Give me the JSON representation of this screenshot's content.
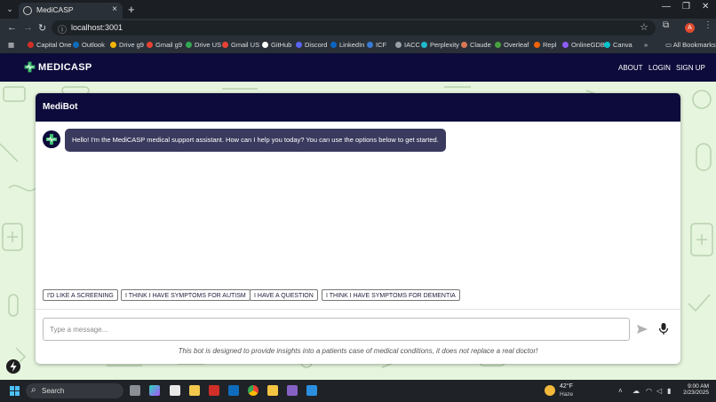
{
  "browser": {
    "tab_title": "MediCASP",
    "tab_close": "×",
    "new_tab": "+",
    "url": "localhost:3001",
    "bookmarks": [
      {
        "label": "Capital One",
        "color": "#d03027"
      },
      {
        "label": "Outlook",
        "color": "#0f6cbd"
      },
      {
        "label": "Drive g9",
        "color": "#f4b400"
      },
      {
        "label": "Gmail g9",
        "color": "#ea4335"
      },
      {
        "label": "Drive US",
        "color": "#34a853"
      },
      {
        "label": "Gmail US",
        "color": "#ea4335"
      },
      {
        "label": "GitHub",
        "color": "#ffffff"
      },
      {
        "label": "Discord",
        "color": "#5865f2"
      },
      {
        "label": "LinkedIn",
        "color": "#0a66c2"
      },
      {
        "label": "ICF",
        "color": "#3a7bd5"
      },
      {
        "label": "IACC",
        "color": "#9aa0a6"
      },
      {
        "label": "Perplexity",
        "color": "#20b8cd"
      },
      {
        "label": "Claude",
        "color": "#d97757"
      },
      {
        "label": "Overleaf",
        "color": "#47a141"
      },
      {
        "label": "Repl",
        "color": "#f26207"
      },
      {
        "label": "OnlineGDB",
        "color": "#8b5cf6"
      },
      {
        "label": "Canva",
        "color": "#00c4cc"
      }
    ],
    "all_bookmarks": "All Bookmarks",
    "profile_initial": "A"
  },
  "site": {
    "brand": "MEDICASP",
    "nav": [
      "ABOUT",
      "LOGIN",
      "SIGN UP"
    ]
  },
  "chat": {
    "title": "MediBot",
    "bot_message": "Hello! I'm the MediCASP medical support assistant. How can I help you today? You can use the options below to get started.",
    "options": [
      "I'D LIKE A SCREENING",
      "I THINK I HAVE SYMPTOMS FOR AUTISM",
      "I HAVE A QUESTION",
      "I THINK I HAVE SYMPTOMS FOR DEMENTIA"
    ],
    "input_placeholder": "Type a message...",
    "disclaimer": "This bot is designed to provide insights into a patients case of medical conditions, it does not replace a real doctor!"
  },
  "taskbar": {
    "search_label": "Search",
    "weather_temp": "42°F",
    "weather_cond": "Haze",
    "time": "9:00 AM",
    "date": "2/23/2025"
  },
  "colors": {
    "navy": "#0d0b3b",
    "bot_bubble": "#3a3a5e",
    "page_bg": "#e6f5dd"
  }
}
